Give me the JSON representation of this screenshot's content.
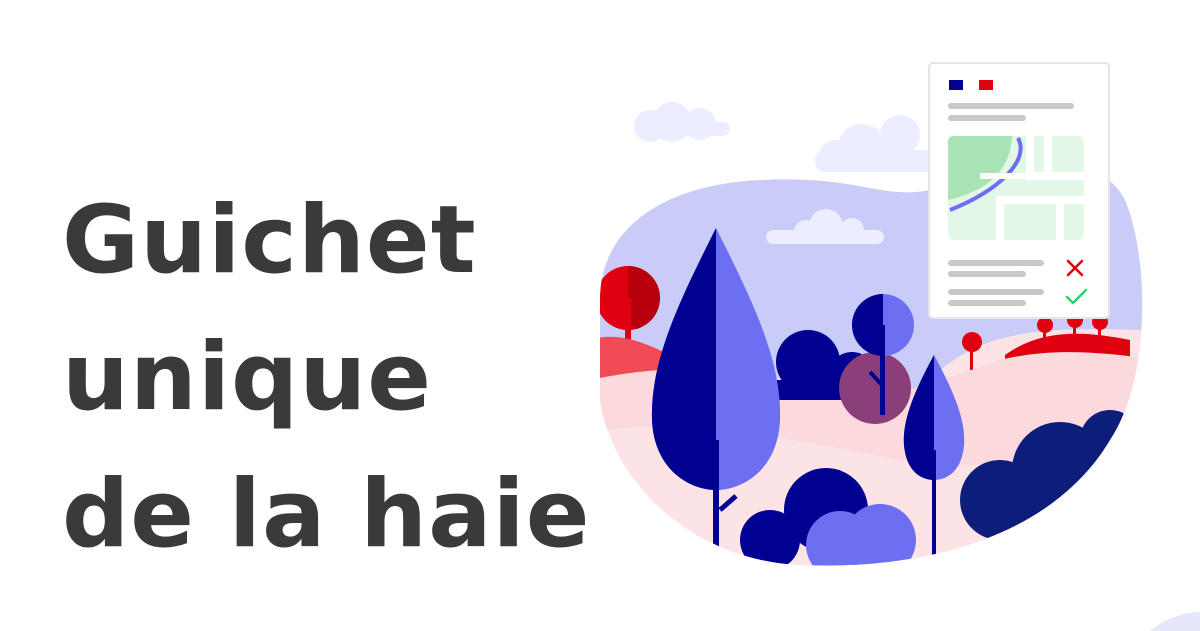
{
  "title": {
    "lines": [
      "Guichet",
      "unique",
      "de la haie"
    ]
  },
  "illustration": {
    "flag_colors": [
      "#000091",
      "#e1000f"
    ],
    "status_icons": [
      "cross-icon",
      "check-icon"
    ],
    "colors": {
      "sky": "#c9ccf6",
      "hill": "#fbd9dd",
      "tree_dark": "#000091",
      "tree_light": "#6c6ff2",
      "tree_red": "#e1000f",
      "reject": "#e1000f",
      "accept": "#2ed26e"
    }
  }
}
